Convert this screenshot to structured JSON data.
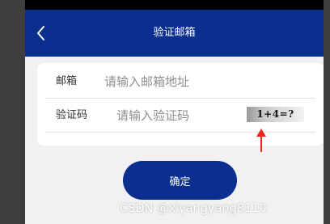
{
  "header": {
    "title": "验证邮箱",
    "back_icon": "chevron-left-icon"
  },
  "form": {
    "email_label": "邮箱",
    "email_placeholder": "请输入邮箱地址",
    "email_value": "",
    "code_label": "验证码",
    "code_placeholder": "请输入验证码",
    "code_value": "",
    "captcha_text": "1+4=?"
  },
  "annotation": {
    "arrow_icon": "red-arrow-up-icon",
    "color": "#e8261d"
  },
  "actions": {
    "confirm_label": "确定"
  },
  "watermark": {
    "text": "CSDN @xiyangyang8110"
  },
  "colors": {
    "brand": "#0a2f8f",
    "background": "#f1f1f3",
    "card": "#ffffff"
  }
}
